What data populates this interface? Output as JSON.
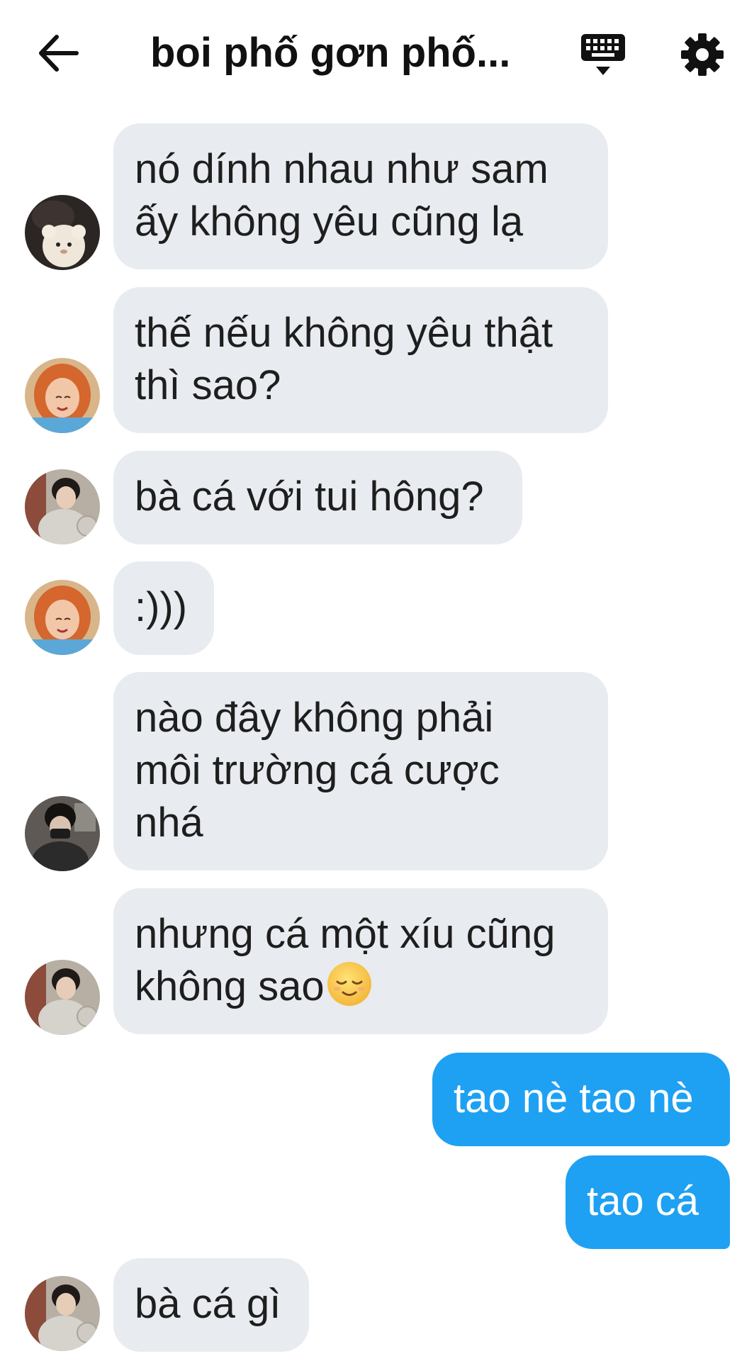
{
  "header": {
    "title": "boi phố gơn phố...",
    "back_icon": "arrow-left-icon",
    "keyboard_icon": "keyboard-icon",
    "settings_icon": "gear-icon"
  },
  "colors": {
    "incoming_bubble": "#e8ebef",
    "outgoing_bubble": "#1ea1f2",
    "outgoing_text": "#ffffff"
  },
  "messages": [
    {
      "direction": "incoming",
      "avatar": "avatar-plush-girl",
      "lines": [
        "nó dính nhau như sam",
        "ấy không yêu cũng lạ"
      ]
    },
    {
      "direction": "incoming",
      "avatar": "avatar-redhair-girl",
      "lines": [
        "thế nếu không yêu thật",
        "thì sao?"
      ]
    },
    {
      "direction": "incoming",
      "avatar": "avatar-boy-sweater",
      "lines": [
        "bà cá với tui hông?"
      ]
    },
    {
      "direction": "incoming",
      "avatar": "avatar-redhair-girl",
      "lines": [
        ":)))"
      ]
    },
    {
      "direction": "incoming",
      "avatar": "avatar-masked-boy",
      "lines": [
        "nào đây không phải",
        "môi trường cá cược",
        "nhá"
      ]
    },
    {
      "direction": "incoming",
      "avatar": "avatar-boy-sweater",
      "lines": [
        "nhưng cá một xíu cũng",
        "không sao"
      ],
      "emoji": "relieved-face-emoji"
    },
    {
      "direction": "outgoing",
      "lines": [
        "tao nè tao nè"
      ]
    },
    {
      "direction": "outgoing",
      "lines": [
        "tao cá"
      ]
    },
    {
      "direction": "incoming",
      "avatar": "avatar-boy-sweater",
      "lines": [
        "bà cá gì"
      ]
    }
  ]
}
